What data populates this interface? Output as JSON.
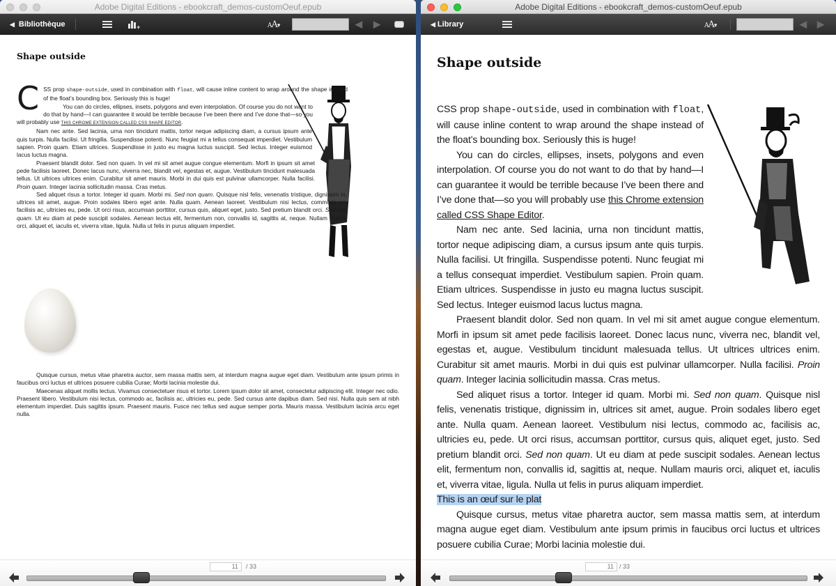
{
  "windows": {
    "left": {
      "title": "Adobe Digital Editions - ebookcraft_demos-customOeuf.epub",
      "toolbar": {
        "back_label": "Bibliothèque",
        "font_size_label": "AA",
        "search_value": ""
      },
      "content": {
        "heading": "Shape outside",
        "dropcap": "C",
        "p1_a": "SS prop ",
        "p1_code1": "shape-outside",
        "p1_b": ", used in combination with ",
        "p1_code2": "float",
        "p1_c": ", will cause inline content to wrap around the shape instead of the float’s bounding box. Seriously this is huge!",
        "p2_a": "You can do circles, ellipses, insets, polygons and even interpolation. Of course you do not want to do that by hand—I can guarantee it would be terrible because I’ve been there and I’ve done that—so you will probably use ",
        "p2_link": "this Chrome extension called CSS Shape Editor",
        "p2_b": ".",
        "p3": "Nam nec ante. Sed lacinia, urna non tincidunt mattis, tortor neque adipiscing diam, a cursus ipsum ante quis turpis. Nulla facilisi. Ut fringilla. Suspendisse potenti. Nunc feugiat mi a tellus consequat imperdiet. Vestibulum sapien. Proin quam. Etiam ultrices. Suspendisse in justo eu magna luctus suscipit. Sed lectus. Integer euismod lacus luctus magna.",
        "p4_a": "Praesent blandit dolor. Sed non quam. In vel mi sit amet augue congue elementum. Morfi in ipsum sit amet pede facilisis laoreet. Donec lacus nunc, viverra nec, blandit vel, egestas et, augue. Vestibulum tincidunt malesuada tellus. Ut ultrices ultrices enim. Curabitur sit amet mauris. Morbi in dui quis est pulvinar ullamcorper. Nulla facilisi. ",
        "p4_em": "Proin quam",
        "p4_b": ". Integer lacinia sollicitudin massa. Cras metus.",
        "p5_a": "Sed aliquet risus a tortor. Integer id quam. Morbi mi. ",
        "p5_em1": "Sed non quam",
        "p5_b": ". Quisque nisl felis, venenatis tristique, dignissim in, ultrices sit amet, augue. Proin sodales libero eget ante. Nulla quam. Aenean laoreet. Vestibulum nisi lectus, commodo ac, facilisis ac, ultricies eu, pede. Ut orci risus, accumsan porttitor, cursus quis, aliquet eget, justo. Sed pretium blandit orci. ",
        "p5_em2": "Sed non quam",
        "p5_c": ". Ut eu diam at pede suscipit sodales. Aenean lectus elit, fermentum non, convallis id, sagittis at, neque. Nullam mauris orci, aliquet et, iaculis et, viverra vitae, ligula. Nulla ut felis in purus aliquam imperdiet.",
        "p6": "Quisque cursus, metus vitae pharetra auctor, sem massa mattis sem, at interdum magna augue eget diam. Vestibulum ante ipsum primis in faucibus orci luctus et ultrices posuere cubilia Curae; Morbi lacinia molestie dui.",
        "p7": "Maecenas aliquet mollis lectus. Vivamus consectetuer risus et tortor. Lorem ipsum dolor sit amet, consectetur adipiscing elit. Integer nec odio. Praesent libero. Vestibulum nisi lectus, commodo ac, facilisis ac, ultricies eu, pede. Sed cursus ante dapibus diam. Sed nisi. Nulla quis sem at nibh elementum imperdiet. Duis sagittis ipsum. Praesent mauris. Fusce nec tellus sed augue semper porta. Mauris massa. Vestibulum lacinia arcu eget nulla."
      },
      "footer": {
        "current_page": "11",
        "total_pages": "/ 33",
        "progress_fraction": 0.31
      }
    },
    "right": {
      "title": "Adobe Digital Editions - ebookcraft_demos-customOeuf.epub",
      "toolbar": {
        "back_label": "Library",
        "font_size_label": "AA",
        "search_value": ""
      },
      "content": {
        "heading": "Shape outside",
        "p1_a": "CSS prop ",
        "p1_code1": "shape-outside",
        "p1_b": ", used in combination with ",
        "p1_code2": "float",
        "p1_c": ", will cause inline content to wrap around the shape instead of the float’s bounding box. Seriously this is huge!",
        "p2_a": "You can do circles, ellipses, insets, polygons and even interpolation. Of course you do not want to do that by hand—I can guarantee it would be terrible because I’ve been there and I’ve done that—so you will probably use ",
        "p2_link": "this Chrome extension called CSS Shape Editor",
        "p2_b": ".",
        "p3": "Nam nec ante. Sed lacinia, urna non tincidunt mattis, tortor neque adipiscing diam, a cursus ipsum ante quis turpis. Nulla facilisi. Ut fringilla. Suspendisse potenti. Nunc feugiat mi a tellus consequat imperdiet. Vestibulum sapien. Proin quam. Etiam ultrices. Suspendisse in justo eu magna luctus suscipit. Sed lectus. Integer euismod lacus luctus magna.",
        "p4_a": "Praesent blandit dolor. Sed non quam. In vel mi sit amet augue congue elementum. Morfi in ipsum sit amet pede facilisis laoreet. Donec lacus nunc, viverra nec, blandit vel, egestas et, augue. Vestibulum tincidunt malesuada tellus. Ut ultrices ultrices enim. Curabitur sit amet mauris. Morbi in dui quis est pulvinar ullamcorper. Nulla facilisi. ",
        "p4_em": "Proin quam",
        "p4_b": ". Integer lacinia sollicitudin massa. Cras metus.",
        "p5_a": "Sed aliquet risus a tortor. Integer id quam. Morbi mi. ",
        "p5_em1": "Sed non quam",
        "p5_b": ". Quisque nisl felis, venenatis tristique, dignissim in, ultrices sit amet, augue. Proin sodales libero eget ante. Nulla quam. Aenean laoreet. Vestibulum nisi lectus, commodo ac, facilisis ac, ultricies eu, pede. Ut orci risus, accumsan porttitor, cursus quis, aliquet eget, justo. Sed pretium blandit orci. ",
        "p5_em2": "Sed non quam",
        "p5_c": ". Ut eu diam at pede suscipit sodales. Aenean lectus elit, fermentum non, convallis id, sagittis at, neque. Nullam mauris orci, aliquet et, iaculis et, viverra vitae, ligula. Nulla ut felis in purus aliquam imperdiet.",
        "egg_alt_text": "This is an œuf sur le plat",
        "p6": "Quisque cursus, metus vitae pharetra auctor, sem massa mattis sem, at interdum magna augue eget diam. Vestibulum ante ipsum primis in faucibus orci luctus et ultrices posuere cubilia Curae; Morbi lacinia molestie dui."
      },
      "footer": {
        "current_page": "11",
        "total_pages": "/ 33",
        "progress_fraction": 0.31
      }
    }
  },
  "colors": {
    "highlight": "#b5d3f3",
    "toolbar_bg": "#2a2a2a"
  }
}
